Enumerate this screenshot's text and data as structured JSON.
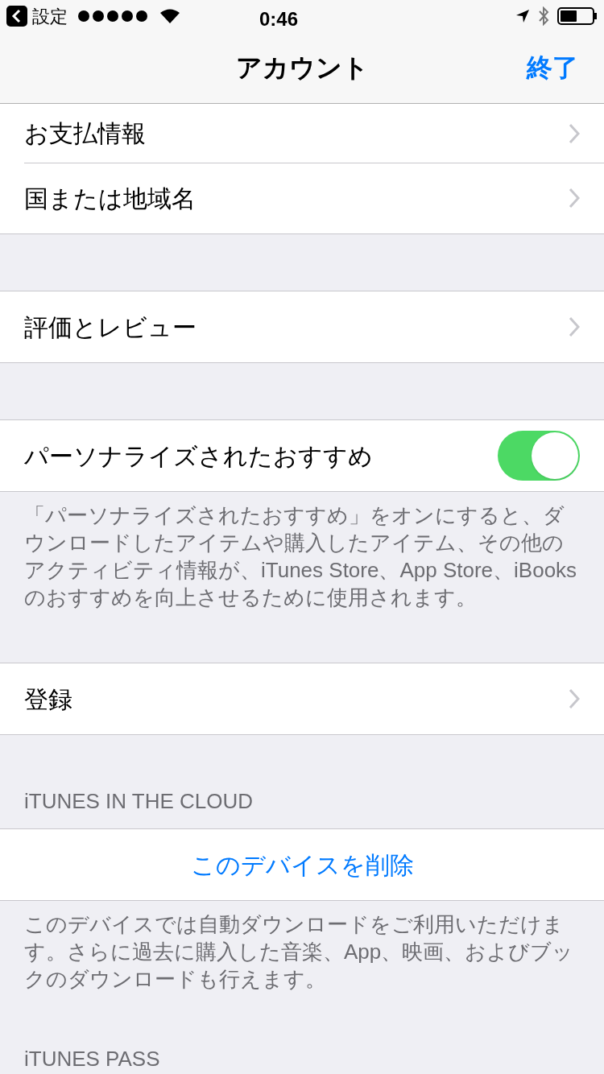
{
  "status_bar": {
    "back_label": "設定",
    "time": "0:46"
  },
  "nav": {
    "title": "アカウント",
    "done": "終了"
  },
  "sections": [
    {
      "rows": [
        {
          "kind": "link",
          "label": "お支払情報"
        },
        {
          "kind": "link",
          "label": "国または地域名"
        }
      ]
    },
    {
      "rows": [
        {
          "kind": "link",
          "label": "評価とレビュー"
        }
      ]
    },
    {
      "rows": [
        {
          "kind": "toggle",
          "label": "パーソナライズされたおすすめ",
          "on": true
        }
      ],
      "footer": "「パーソナライズされたおすすめ」をオンにすると、ダウンロードしたアイテムや購入したアイテム、その他のアクティビティ情報が、iTunes Store、App Store、iBooksのおすすめを向上させるために使用されます。"
    },
    {
      "rows": [
        {
          "kind": "link",
          "label": "登録"
        }
      ]
    },
    {
      "header": "iTUNES IN THE CLOUD",
      "rows": [
        {
          "kind": "button",
          "label": "このデバイスを削除"
        }
      ],
      "footer": "このデバイスでは自動ダウンロードをご利用いただけます。さらに過去に購入した音楽、App、映画、およびブックのダウンロードも行えます。"
    },
    {
      "header": "iTUNES PASS"
    }
  ]
}
